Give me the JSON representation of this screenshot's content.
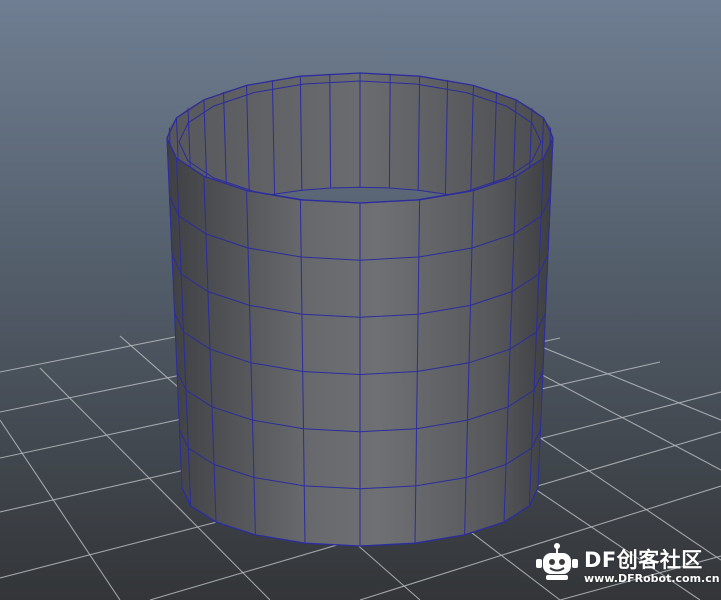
{
  "scene": {
    "object": "cylinder",
    "display_mode": "wireframe-on-shaded",
    "radial_segments": 20,
    "height_segments": 6,
    "ground_grid": true,
    "colors": {
      "background_top": "#6f7e92",
      "background_mid": "#505a66",
      "background_bottom": "#333538",
      "grid_line": "#b4b8bc",
      "wire": "#2c2c9e",
      "surface_light": "#74767a",
      "surface_dark": "#3c3e41"
    }
  },
  "watermark": {
    "title": "DF创客社区",
    "url": "www.DFRobot.com.cn"
  }
}
